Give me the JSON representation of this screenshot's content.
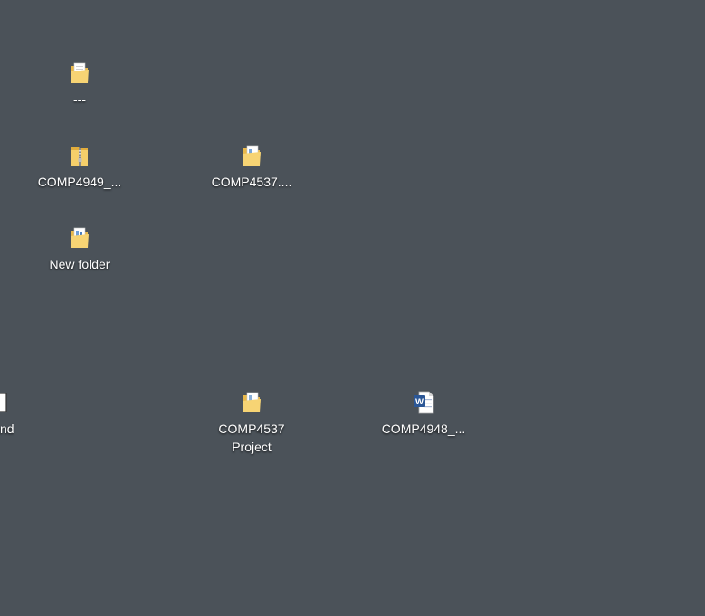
{
  "desktop": {
    "background_color": "#4b5259",
    "icons": [
      {
        "label": "---",
        "icon": "folder-icon"
      },
      {
        "label": "COMP4949_...",
        "icon": "zip-folder-icon"
      },
      {
        "label": "COMP4537....",
        "icon": "folder-icon"
      },
      {
        "label": "New folder",
        "icon": "folder-icon"
      },
      {
        "label": "ound",
        "icon": "document-icon"
      },
      {
        "label": "COMP4537\nProject",
        "icon": "folder-icon"
      },
      {
        "label": "COMP4948_...",
        "icon": "word-document-icon"
      }
    ]
  }
}
